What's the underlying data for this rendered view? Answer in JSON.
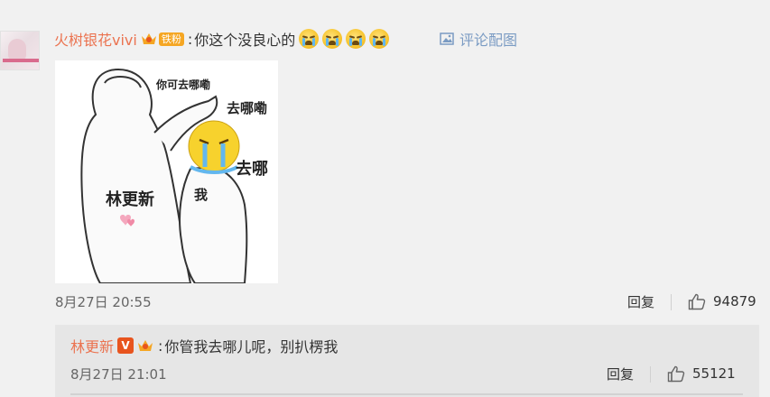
{
  "comment": {
    "username": "火树银花vivi",
    "fan_badge": "铁粉",
    "colon": ":",
    "text": "你这个没良心的",
    "emojis": [
      "crying-face",
      "crying-face",
      "crying-face",
      "crying-face"
    ],
    "pic_link_label": "评论配图",
    "meme": {
      "caption_top": "你可去哪嘞",
      "caption_mid": "去哪嘞",
      "caption_right": "去哪",
      "label_left": "林更新",
      "label_right": "我"
    },
    "date": "8月27日 20:55",
    "reply_label": "回复",
    "like_count": "94879"
  },
  "reply": {
    "username": "林更新",
    "verified_badge": "V",
    "colon": ":",
    "text": "你管我去哪儿呢，别扒楞我",
    "date": "8月27日 21:01",
    "reply_label": "回复",
    "like_count": "55121"
  },
  "colors": {
    "username": "#eb7350",
    "link": "#7a9bc3",
    "background": "#f1f1f1",
    "reply_background": "#e6e6e6"
  }
}
